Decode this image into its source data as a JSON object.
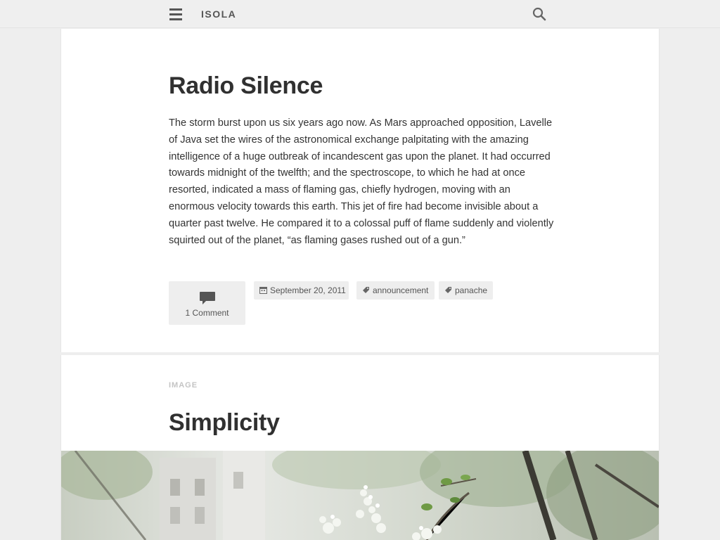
{
  "header": {
    "site_title": "ISOLA",
    "menu_icon": "hamburger-menu-icon",
    "search_icon": "search-icon"
  },
  "posts": [
    {
      "title": "Radio Silence",
      "body": "The storm burst upon us six years ago now. As Mars approached opposition, Lavelle of Java set the wires of the astronomical exchange palpitating with the amazing intelligence of a huge outbreak of incandescent gas upon the planet. It had occurred towards midnight of the twelfth; and the spectroscope, to which he had at once resorted, indicated a mass of flaming gas, chiefly hydrogen, moving with an enormous velocity towards this earth. This jet of fire had become invisible about a quarter past twelve. He compared it to a colossal puff of flame suddenly and violently squirted out of the planet, “as flaming gases rushed out of a gun.”",
      "comments": "1 Comment",
      "date": "September 20, 2011",
      "tags": [
        "announcement",
        "panache"
      ]
    },
    {
      "format": "IMAGE",
      "title": "Simplicity"
    }
  ],
  "colors": {
    "background": "#eeeeee",
    "card": "#ffffff",
    "text": "#303030",
    "meta_bg": "#eeeeee",
    "format_label": "#c4c4c4"
  }
}
